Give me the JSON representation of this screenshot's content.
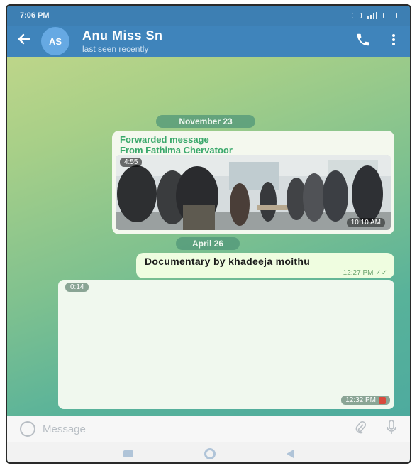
{
  "status_bar": {
    "time": "7:06 PM"
  },
  "header": {
    "avatar_initials": "AS",
    "contact_name": "Anu Miss Sn",
    "contact_status": "last seen recently",
    "back_icon": "arrow-left-icon",
    "call_icon": "phone-icon",
    "more_icon": "more-vertical-icon"
  },
  "messages": {
    "date_1": "November 23",
    "forwarded_label": "Forwarded message",
    "forwarded_from": "From Fathima Chervatoor",
    "video_duration": "4:55",
    "video_time": "10:10 AM",
    "date_2": "April 26",
    "text_message": "Documentary by khadeeja moithu",
    "text_time": "12:27 PM",
    "media_duration": "0:14",
    "media_time": "12:32 PM"
  },
  "input_bar": {
    "placeholder": "Message",
    "emoji_icon": "emoji-icon",
    "attach_icon": "paperclip-icon",
    "mic_icon": "microphone-icon"
  },
  "colors": {
    "header": "#3f84bb",
    "status_bar": "#3d7fb3",
    "forwarded_text": "#3aa86b",
    "outgoing_bubble": "#effde0"
  }
}
